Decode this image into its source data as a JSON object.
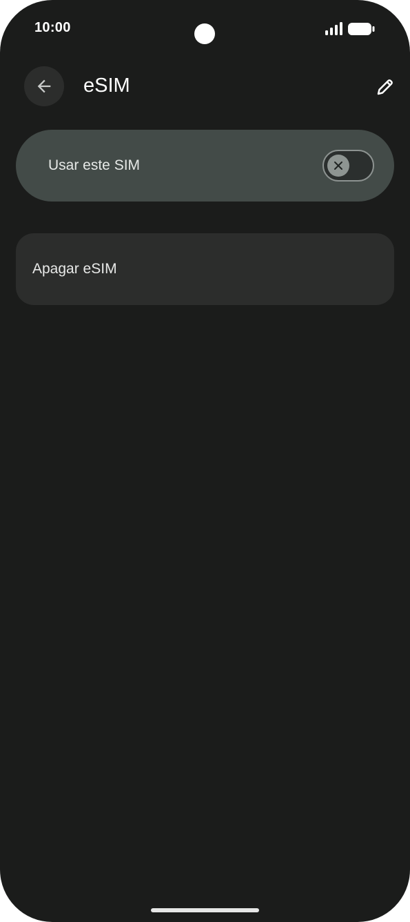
{
  "status_bar": {
    "time": "10:00"
  },
  "app_bar": {
    "back_icon": "arrow-left-icon",
    "title": "eSIM",
    "edit_icon": "pencil-icon"
  },
  "settings": {
    "use_sim": {
      "label": "Usar este SIM",
      "toggle_on": false,
      "toggle_icon": "close-icon"
    },
    "delete_esim": {
      "label": "Apagar eSIM"
    }
  },
  "colors": {
    "background": "#1b1c1b",
    "highlight_card": "#434b48",
    "card": "#2c2d2c",
    "text_primary": "#ffffff"
  }
}
